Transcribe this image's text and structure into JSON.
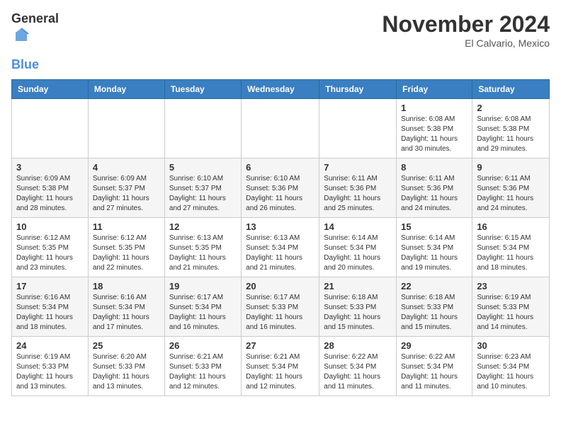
{
  "header": {
    "logo_general": "General",
    "logo_blue": "Blue",
    "month_title": "November 2024",
    "location": "El Calvario, Mexico"
  },
  "weekdays": [
    "Sunday",
    "Monday",
    "Tuesday",
    "Wednesday",
    "Thursday",
    "Friday",
    "Saturday"
  ],
  "weeks": [
    [
      {
        "day": "",
        "sunrise": "",
        "sunset": "",
        "daylight": ""
      },
      {
        "day": "",
        "sunrise": "",
        "sunset": "",
        "daylight": ""
      },
      {
        "day": "",
        "sunrise": "",
        "sunset": "",
        "daylight": ""
      },
      {
        "day": "",
        "sunrise": "",
        "sunset": "",
        "daylight": ""
      },
      {
        "day": "",
        "sunrise": "",
        "sunset": "",
        "daylight": ""
      },
      {
        "day": "1",
        "sunrise": "Sunrise: 6:08 AM",
        "sunset": "Sunset: 5:38 PM",
        "daylight": "Daylight: 11 hours and 30 minutes."
      },
      {
        "day": "2",
        "sunrise": "Sunrise: 6:08 AM",
        "sunset": "Sunset: 5:38 PM",
        "daylight": "Daylight: 11 hours and 29 minutes."
      }
    ],
    [
      {
        "day": "3",
        "sunrise": "Sunrise: 6:09 AM",
        "sunset": "Sunset: 5:38 PM",
        "daylight": "Daylight: 11 hours and 28 minutes."
      },
      {
        "day": "4",
        "sunrise": "Sunrise: 6:09 AM",
        "sunset": "Sunset: 5:37 PM",
        "daylight": "Daylight: 11 hours and 27 minutes."
      },
      {
        "day": "5",
        "sunrise": "Sunrise: 6:10 AM",
        "sunset": "Sunset: 5:37 PM",
        "daylight": "Daylight: 11 hours and 27 minutes."
      },
      {
        "day": "6",
        "sunrise": "Sunrise: 6:10 AM",
        "sunset": "Sunset: 5:36 PM",
        "daylight": "Daylight: 11 hours and 26 minutes."
      },
      {
        "day": "7",
        "sunrise": "Sunrise: 6:11 AM",
        "sunset": "Sunset: 5:36 PM",
        "daylight": "Daylight: 11 hours and 25 minutes."
      },
      {
        "day": "8",
        "sunrise": "Sunrise: 6:11 AM",
        "sunset": "Sunset: 5:36 PM",
        "daylight": "Daylight: 11 hours and 24 minutes."
      },
      {
        "day": "9",
        "sunrise": "Sunrise: 6:11 AM",
        "sunset": "Sunset: 5:36 PM",
        "daylight": "Daylight: 11 hours and 24 minutes."
      }
    ],
    [
      {
        "day": "10",
        "sunrise": "Sunrise: 6:12 AM",
        "sunset": "Sunset: 5:35 PM",
        "daylight": "Daylight: 11 hours and 23 minutes."
      },
      {
        "day": "11",
        "sunrise": "Sunrise: 6:12 AM",
        "sunset": "Sunset: 5:35 PM",
        "daylight": "Daylight: 11 hours and 22 minutes."
      },
      {
        "day": "12",
        "sunrise": "Sunrise: 6:13 AM",
        "sunset": "Sunset: 5:35 PM",
        "daylight": "Daylight: 11 hours and 21 minutes."
      },
      {
        "day": "13",
        "sunrise": "Sunrise: 6:13 AM",
        "sunset": "Sunset: 5:34 PM",
        "daylight": "Daylight: 11 hours and 21 minutes."
      },
      {
        "day": "14",
        "sunrise": "Sunrise: 6:14 AM",
        "sunset": "Sunset: 5:34 PM",
        "daylight": "Daylight: 11 hours and 20 minutes."
      },
      {
        "day": "15",
        "sunrise": "Sunrise: 6:14 AM",
        "sunset": "Sunset: 5:34 PM",
        "daylight": "Daylight: 11 hours and 19 minutes."
      },
      {
        "day": "16",
        "sunrise": "Sunrise: 6:15 AM",
        "sunset": "Sunset: 5:34 PM",
        "daylight": "Daylight: 11 hours and 18 minutes."
      }
    ],
    [
      {
        "day": "17",
        "sunrise": "Sunrise: 6:16 AM",
        "sunset": "Sunset: 5:34 PM",
        "daylight": "Daylight: 11 hours and 18 minutes."
      },
      {
        "day": "18",
        "sunrise": "Sunrise: 6:16 AM",
        "sunset": "Sunset: 5:34 PM",
        "daylight": "Daylight: 11 hours and 17 minutes."
      },
      {
        "day": "19",
        "sunrise": "Sunrise: 6:17 AM",
        "sunset": "Sunset: 5:34 PM",
        "daylight": "Daylight: 11 hours and 16 minutes."
      },
      {
        "day": "20",
        "sunrise": "Sunrise: 6:17 AM",
        "sunset": "Sunset: 5:33 PM",
        "daylight": "Daylight: 11 hours and 16 minutes."
      },
      {
        "day": "21",
        "sunrise": "Sunrise: 6:18 AM",
        "sunset": "Sunset: 5:33 PM",
        "daylight": "Daylight: 11 hours and 15 minutes."
      },
      {
        "day": "22",
        "sunrise": "Sunrise: 6:18 AM",
        "sunset": "Sunset: 5:33 PM",
        "daylight": "Daylight: 11 hours and 15 minutes."
      },
      {
        "day": "23",
        "sunrise": "Sunrise: 6:19 AM",
        "sunset": "Sunset: 5:33 PM",
        "daylight": "Daylight: 11 hours and 14 minutes."
      }
    ],
    [
      {
        "day": "24",
        "sunrise": "Sunrise: 6:19 AM",
        "sunset": "Sunset: 5:33 PM",
        "daylight": "Daylight: 11 hours and 13 minutes."
      },
      {
        "day": "25",
        "sunrise": "Sunrise: 6:20 AM",
        "sunset": "Sunset: 5:33 PM",
        "daylight": "Daylight: 11 hours and 13 minutes."
      },
      {
        "day": "26",
        "sunrise": "Sunrise: 6:21 AM",
        "sunset": "Sunset: 5:33 PM",
        "daylight": "Daylight: 11 hours and 12 minutes."
      },
      {
        "day": "27",
        "sunrise": "Sunrise: 6:21 AM",
        "sunset": "Sunset: 5:34 PM",
        "daylight": "Daylight: 11 hours and 12 minutes."
      },
      {
        "day": "28",
        "sunrise": "Sunrise: 6:22 AM",
        "sunset": "Sunset: 5:34 PM",
        "daylight": "Daylight: 11 hours and 11 minutes."
      },
      {
        "day": "29",
        "sunrise": "Sunrise: 6:22 AM",
        "sunset": "Sunset: 5:34 PM",
        "daylight": "Daylight: 11 hours and 11 minutes."
      },
      {
        "day": "30",
        "sunrise": "Sunrise: 6:23 AM",
        "sunset": "Sunset: 5:34 PM",
        "daylight": "Daylight: 11 hours and 10 minutes."
      }
    ]
  ]
}
